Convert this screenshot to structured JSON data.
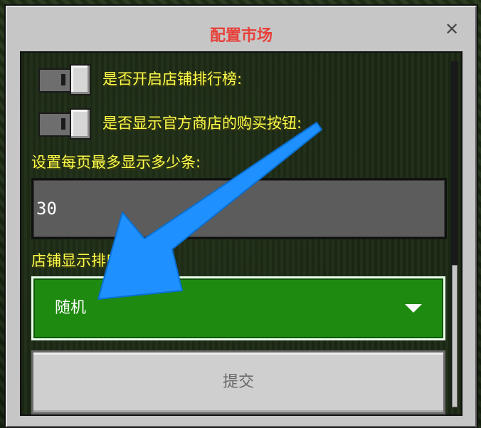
{
  "dialog": {
    "title": "配置市场",
    "close_icon": "close-icon"
  },
  "settings": {
    "toggle_leaderboard_label": "是否开启店铺排行榜:",
    "toggle_leaderboard_on": false,
    "toggle_buy_button_label": "是否显示官方商店的购买按钮:",
    "toggle_buy_button_on": false,
    "per_page_label": "设置每页最多显示多少条:",
    "per_page_value": "30",
    "sort_label": "店铺显示排序方式:",
    "sort_selected": "随机",
    "submit_label": "提交"
  },
  "annotation": {
    "arrow_color": "#1e90ff"
  }
}
